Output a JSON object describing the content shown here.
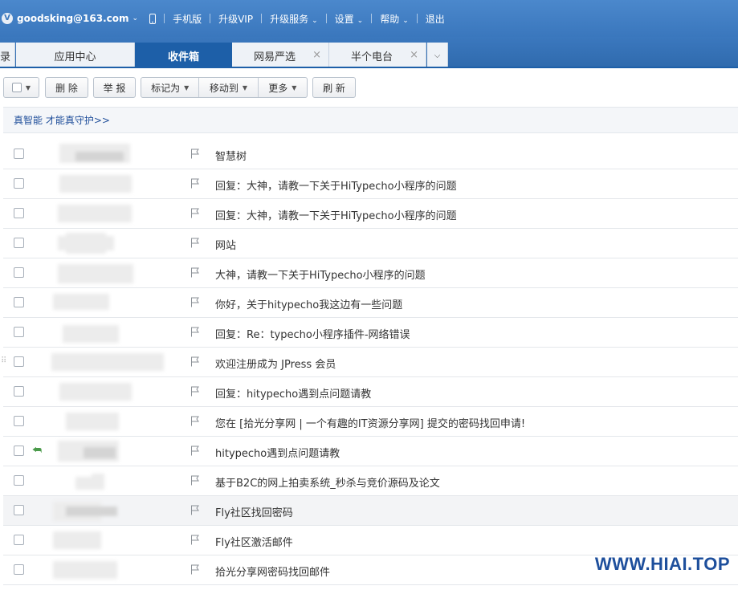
{
  "topbar": {
    "vip_badge": "V",
    "account": "goodsking@163.com",
    "links": [
      "手机版",
      "升级VIP",
      "升级服务",
      "设置",
      "帮助",
      "退出"
    ]
  },
  "tabs": [
    {
      "label": "录",
      "closable": false,
      "active": false
    },
    {
      "label": "应用中心",
      "closable": false,
      "active": false
    },
    {
      "label": "收件箱",
      "closable": false,
      "active": true
    },
    {
      "label": "网易严选",
      "closable": true,
      "active": false
    },
    {
      "label": "半个电台",
      "closable": true,
      "active": false
    }
  ],
  "tab_close_glyph": "×",
  "toolbar": {
    "delete": "删 除",
    "report": "举 报",
    "mark_as": "标记为",
    "move_to": "移动到",
    "more": "更多",
    "refresh": "刷 新"
  },
  "banner": {
    "text": "真智能 才能真守护>>"
  },
  "mails": [
    {
      "subject": "智慧树"
    },
    {
      "subject": "回复：大神，请教一下关于HiTypecho小程序的问题"
    },
    {
      "subject": "回复：大神，请教一下关于HiTypecho小程序的问题"
    },
    {
      "subject": "网站"
    },
    {
      "subject": "大神，请教一下关于HiTypecho小程序的问题"
    },
    {
      "subject": "你好，关于hitypecho我这边有一些问题"
    },
    {
      "subject": "回复：Re：typecho小程序插件-网络错误"
    },
    {
      "subject": "欢迎注册成为 JPress 会员"
    },
    {
      "subject": "回复：hitypecho遇到点问题请教"
    },
    {
      "subject": "您在 [拾光分享网 | 一个有趣的IT资源分享网] 提交的密码找回申请!"
    },
    {
      "subject": "hitypecho遇到点问题请教"
    },
    {
      "subject": "基于B2C的网上拍卖系统_秒杀与竞价源码及论文"
    },
    {
      "subject": "Fly社区找回密码"
    },
    {
      "subject": "Fly社区激活邮件"
    },
    {
      "subject": "拾光分享网密码找回邮件"
    }
  ],
  "watermark": "WWW.HIAI.TOP",
  "colors": {
    "topbar": "#3a77bd",
    "active_tab": "#1d5fa8",
    "banner_link": "#1f4e9a",
    "reply_icon": "#4a9a4a"
  }
}
